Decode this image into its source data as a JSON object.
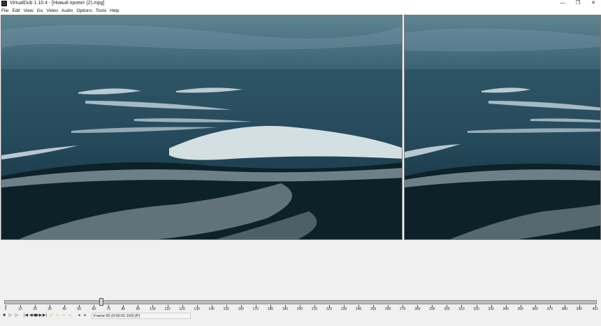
{
  "window": {
    "title": "VirtualDub 1.10.4 - [Новый проект (2).mpg]",
    "minimize": "—",
    "maximize": "❐",
    "close": "✕"
  },
  "menu": [
    "File",
    "Edit",
    "View",
    "Go",
    "Video",
    "Audio",
    "Options",
    "Tools",
    "Help"
  ],
  "timeline": {
    "labels": [
      "0",
      "10",
      "20",
      "30",
      "40",
      "50",
      "60",
      "70",
      "80",
      "90",
      "100",
      "110",
      "120",
      "130",
      "140",
      "150",
      "160",
      "170",
      "180",
      "190",
      "200",
      "210",
      "220",
      "230",
      "240",
      "250",
      "260",
      "270",
      "280",
      "290",
      "300",
      "310",
      "320",
      "330",
      "340",
      "350",
      "360",
      "370",
      "380",
      "390",
      "401"
    ],
    "max_frame": 401,
    "current_frame": 65
  },
  "toolbar": {
    "buttons": [
      "stop",
      "play-input",
      "play-output",
      "go-start",
      "prev-frame",
      "next-frame",
      "go-end",
      "prev-key",
      "next-key",
      "prev-scene",
      "next-scene",
      "mark-in",
      "mark-out"
    ],
    "glyphs": [
      "■",
      "▷",
      "▷",
      "|◀",
      "◀◀",
      "▶▶",
      "▶|",
      "⌂",
      "⌂",
      "⌂",
      "⌂",
      "◂",
      "▸"
    ],
    "frame_status": "Frame 65 (0:00:02.169) [P]"
  }
}
